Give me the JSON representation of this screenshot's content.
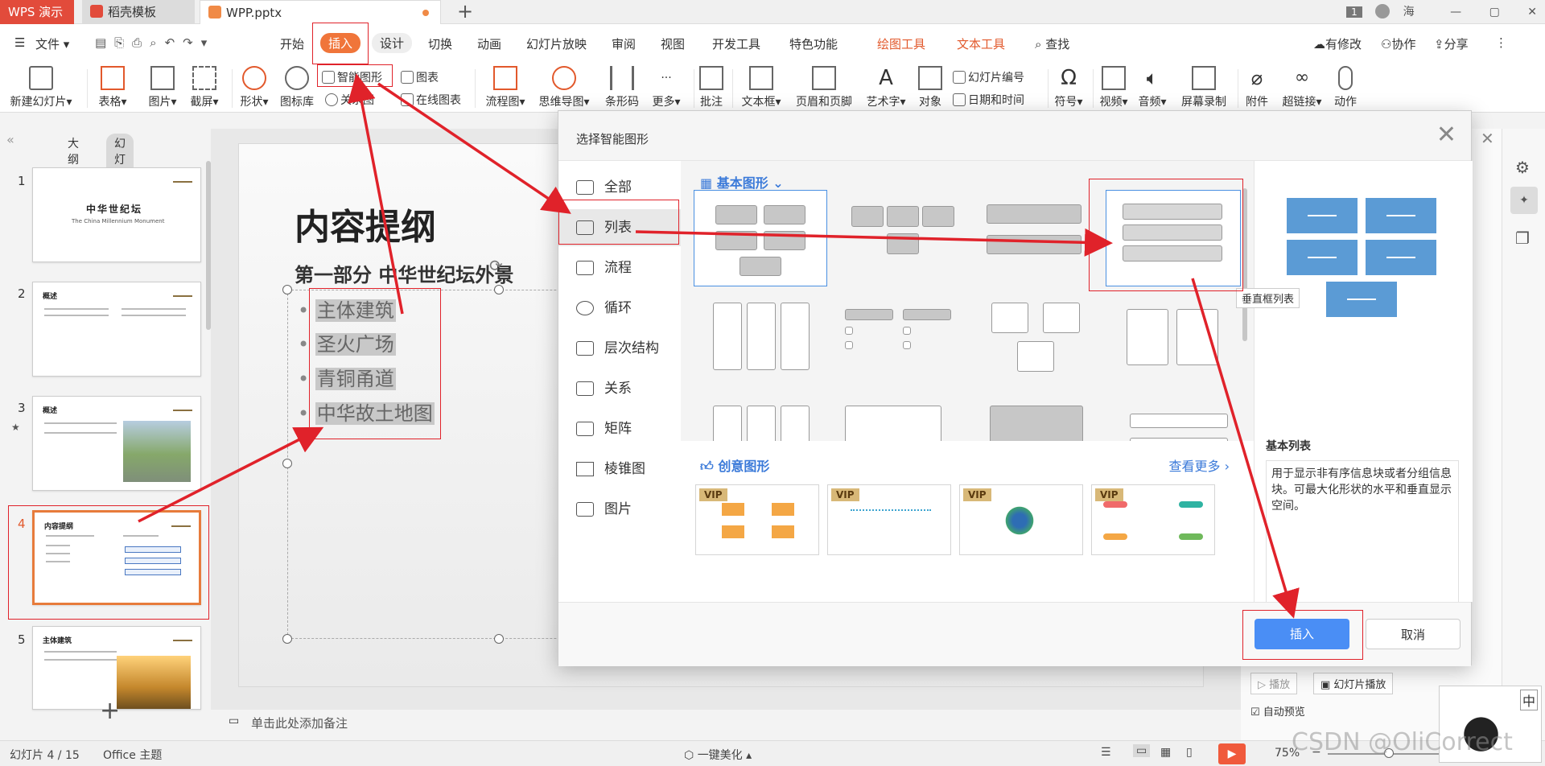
{
  "titlebar": {
    "tabs": [
      {
        "label": "WPS 演示"
      },
      {
        "label": "稻壳模板"
      },
      {
        "label": "WPP.pptx"
      }
    ],
    "badge": "1",
    "user": "海"
  },
  "menu": {
    "file": "文件",
    "items": [
      "开始",
      "插入",
      "设计",
      "切换",
      "动画",
      "幻灯片放映",
      "审阅",
      "视图",
      "开发工具",
      "特色功能"
    ],
    "context": [
      "绘图工具",
      "文本工具"
    ],
    "search": "查找",
    "right": [
      "有修改",
      "协作",
      "分享"
    ]
  },
  "ribbon": {
    "new_slide": "新建幻灯片",
    "table": "表格",
    "picture": "图片",
    "screenshot": "截屏",
    "shape": "形状",
    "icon_lib": "图标库",
    "smartart": "智能图形",
    "relation": "关系图",
    "chart": "图表",
    "online_chart": "在线图表",
    "flowchart": "流程图",
    "mindmap": "思维导图",
    "barcode": "条形码",
    "more": "更多",
    "comment": "批注",
    "textbox": "文本框",
    "header_footer": "页眉和页脚",
    "wordart": "艺术字",
    "object": "对象",
    "slide_number": "幻灯片编号",
    "datetime": "日期和时间",
    "symbol": "符号",
    "video": "视频",
    "audio": "音频",
    "screen_record": "屏幕录制",
    "attachment": "附件",
    "hyperlink": "超链接",
    "action": "动作"
  },
  "leftpanel": {
    "tab_outline": "大纲",
    "tab_slides": "幻灯片",
    "thumbs": [
      {
        "num": "1",
        "title": "中华世纪坛",
        "subtitle": "The China Millennium Monument"
      },
      {
        "num": "2",
        "title": "概述"
      },
      {
        "num": "3",
        "title": "概述"
      },
      {
        "num": "4",
        "title": "内容提纲"
      },
      {
        "num": "5",
        "title": "主体建筑"
      }
    ]
  },
  "slide": {
    "title": "内容提纲",
    "subtitle": "第一部分 中华世纪坛外景",
    "bullets": [
      "主体建筑",
      "圣火广场",
      "青铜甬道",
      "中华故土地图"
    ]
  },
  "notes": {
    "placeholder": "单击此处添加备注"
  },
  "modal": {
    "title": "选择智能图形",
    "nav": [
      "全部",
      "列表",
      "流程",
      "循环",
      "层次结构",
      "关系",
      "矩阵",
      "棱锥图",
      "图片"
    ],
    "basic_title": "基本图形",
    "creative_title": "创意图形",
    "more_link": "查看更多",
    "vip": "VIP",
    "tooltip": "垂直框列表",
    "preview_name": "基本列表",
    "preview_desc": "用于显示非有序信息块或者分组信息块。可最大化形状的水平和垂直显示空间。",
    "insert": "插入",
    "cancel": "取消"
  },
  "rightpanel": {
    "play": "播放",
    "slideshow": "幻灯片播放",
    "auto_preview": "自动预览"
  },
  "statusbar": {
    "slide_info": "幻灯片 4 / 15",
    "theme": "Office 主题",
    "beautify": "一键美化",
    "zoom": "75%"
  },
  "watermark": "CSDN @OliCorrect",
  "colors": {
    "accent": "#f0753a",
    "annotation": "#e0222a",
    "blue": "#4a8ef5"
  }
}
